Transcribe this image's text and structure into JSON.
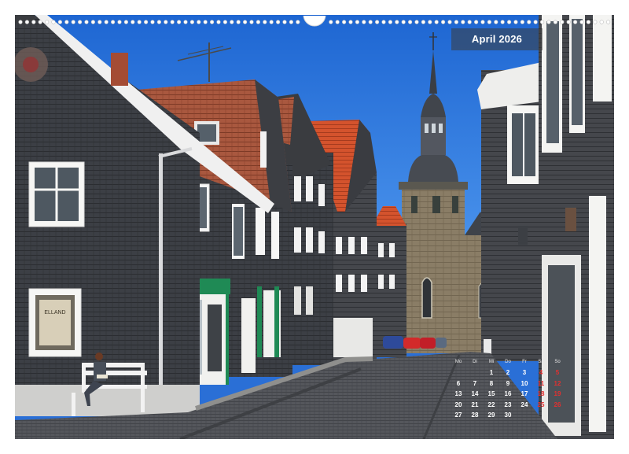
{
  "header": {
    "month_label": "April 2026"
  },
  "calendar": {
    "weekday_labels": [
      "Mo",
      "Di",
      "Mi",
      "Do",
      "Fr",
      "Sa",
      "So"
    ],
    "rows": [
      [
        "",
        "",
        "1",
        "2",
        "3",
        "4",
        "5"
      ],
      [
        "6",
        "7",
        "8",
        "9",
        "10",
        "11",
        "12"
      ],
      [
        "13",
        "14",
        "15",
        "16",
        "17",
        "18",
        "19"
      ],
      [
        "20",
        "21",
        "22",
        "23",
        "24",
        "25",
        "26"
      ],
      [
        "27",
        "28",
        "29",
        "30",
        "",
        "",
        ""
      ]
    ],
    "weekend_color": "#e23030",
    "text_color": "#ffffff"
  },
  "photo": {
    "shop_sign": "ELLAND"
  },
  "colors": {
    "sky": "#2f7be0",
    "slate": "#3d4046",
    "roof_tile": "#c9542f",
    "stone_tower": "#8a7c64",
    "door_green": "#1f8a55"
  }
}
